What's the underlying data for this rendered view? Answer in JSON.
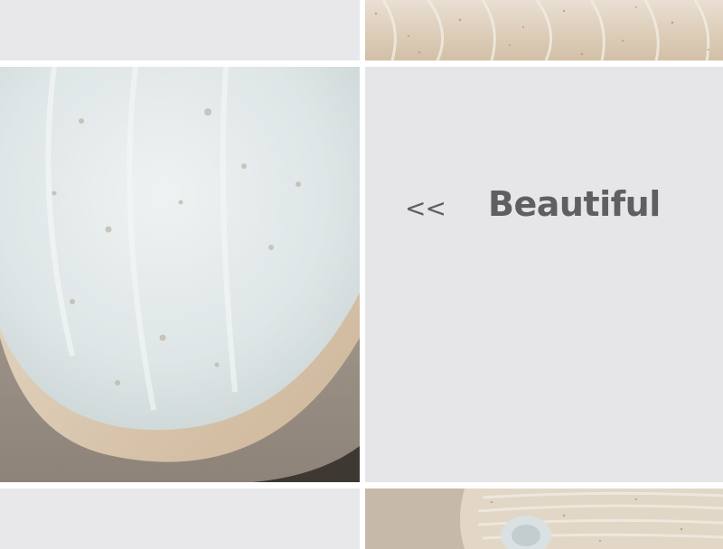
{
  "panel": {
    "arrows": "<<",
    "caption": "Beautiful"
  },
  "images": {
    "top_right": "stoneware-texture",
    "mid_left": "cup-interior-closeup",
    "bottom_right": "cup-with-handle"
  },
  "colors": {
    "tile_bg": "#e8e8ea",
    "panel_bg": "#e6e6e8",
    "text": "#5f5f61",
    "glaze": "#dfe7ea",
    "clay": "#d6c4ae"
  }
}
